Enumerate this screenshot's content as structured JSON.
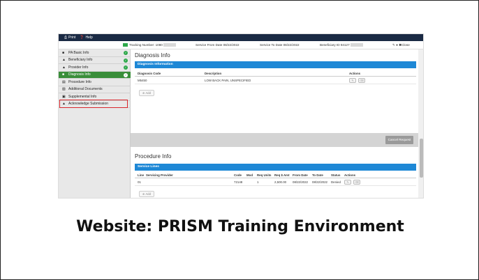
{
  "topbar": {
    "print_label": "Print",
    "help_label": "Help"
  },
  "infobar": {
    "tracking_label": "Tracking Number: 1080",
    "service_from": "Service From Date 08/22/2022",
    "service_to": "Service To Date 08/22/2022",
    "beneficiary": "Beneficiary ID 94127",
    "close_label": "Close"
  },
  "sidebar": {
    "items": [
      {
        "label": "PA Basic Info",
        "icon": "document-icon"
      },
      {
        "label": "Beneficiary Info",
        "icon": "user-icon"
      },
      {
        "label": "Provider Info",
        "icon": "users-icon"
      },
      {
        "label": "Diagnosis Info",
        "icon": "document-icon"
      },
      {
        "label": "Procedure Info",
        "icon": "list-icon"
      },
      {
        "label": "Additional Documents",
        "icon": "files-icon"
      },
      {
        "label": "Supplemental Info",
        "icon": "briefcase-icon"
      },
      {
        "label": "Acknowledge Submission",
        "icon": "user-icon"
      }
    ]
  },
  "diagnosis": {
    "title": "Diagnosis Info",
    "bar_label": "Diagnosis Information",
    "columns": [
      "Diagnosis Code",
      "Description",
      "Actions"
    ],
    "rows": [
      {
        "code": "M5450",
        "description": "LOW BACK PAIN, UNSPECIFIED"
      }
    ],
    "add_label": "Add"
  },
  "cancel_label": "Cancel Request",
  "procedure": {
    "title": "Procedure Info",
    "bar_label": "Service Lines",
    "columns": [
      "Line",
      "Servicing Provider",
      "Code",
      "Mod",
      "Req Units",
      "Req $ Amt",
      "From Date",
      "To Date",
      "Status",
      "Actions"
    ],
    "rows": [
      {
        "line": "01",
        "provider": "",
        "code": "72148",
        "mod": "",
        "units": "1",
        "amount": "2,500.00",
        "from": "08/22/2022",
        "to": "08/22/2022",
        "status": "Denied"
      }
    ],
    "add_label": "Add"
  },
  "caption": "Website: PRISM Training Environment"
}
